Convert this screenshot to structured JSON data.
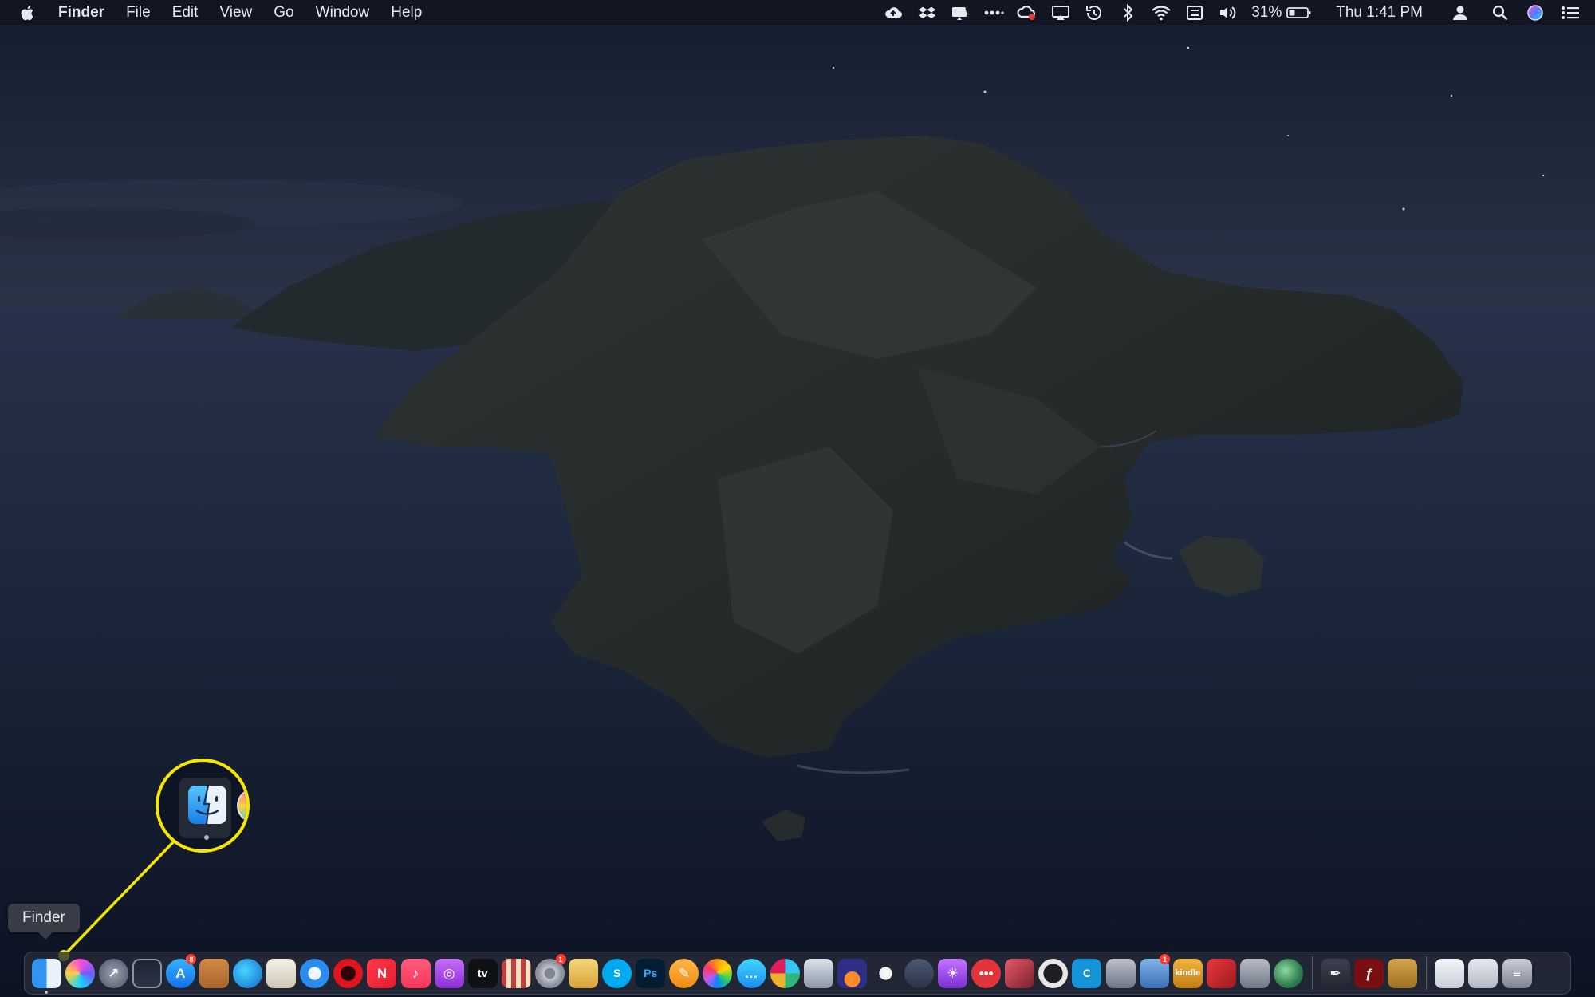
{
  "menubar": {
    "apple_icon": "apple-logo-icon",
    "app_name": "Finder",
    "menus": [
      "File",
      "Edit",
      "View",
      "Go",
      "Window",
      "Help"
    ],
    "status": {
      "battery_percent": "31%",
      "clock": "Thu 1:41 PM"
    }
  },
  "tooltip": {
    "label": "Finder"
  },
  "callout": {
    "color": "#f4e600",
    "target": "Finder"
  },
  "dock": {
    "apps": [
      {
        "name": "Finder",
        "icon": "finder-icon",
        "running": true
      },
      {
        "name": "Siri",
        "icon": "siri-icon"
      },
      {
        "name": "Launchpad",
        "icon": "rocket-icon"
      },
      {
        "name": "Mission Control",
        "icon": "mission-control-icon"
      },
      {
        "name": "App Store",
        "icon": "app-store-icon",
        "badge": "8"
      },
      {
        "name": "Notebook",
        "icon": "notebook-icon"
      },
      {
        "name": "Edge",
        "icon": "edge-icon"
      },
      {
        "name": "Notes",
        "icon": "notes-icon"
      },
      {
        "name": "Safari",
        "icon": "safari-icon"
      },
      {
        "name": "Opera",
        "icon": "opera-icon"
      },
      {
        "name": "News",
        "icon": "news-icon"
      },
      {
        "name": "Music",
        "icon": "music-icon"
      },
      {
        "name": "Podcasts",
        "icon": "podcasts-icon"
      },
      {
        "name": "Apple TV",
        "icon": "apple-tv-icon",
        "label": "tv"
      },
      {
        "name": "Photo Booth",
        "icon": "photo-grid-icon"
      },
      {
        "name": "System Preferences",
        "icon": "gear-icon",
        "badge": "1"
      },
      {
        "name": "Preview",
        "icon": "preview-icon"
      },
      {
        "name": "Skype",
        "icon": "skype-icon",
        "label": "S"
      },
      {
        "name": "Photoshop",
        "icon": "photoshop-icon",
        "label": "Ps"
      },
      {
        "name": "Pages",
        "icon": "pages-icon"
      },
      {
        "name": "Photos",
        "icon": "photos-icon"
      },
      {
        "name": "Messages",
        "icon": "messages-icon"
      },
      {
        "name": "Slack",
        "icon": "slack-icon"
      },
      {
        "name": "Image Capture",
        "icon": "image-capture-icon"
      },
      {
        "name": "Mastodon",
        "icon": "sunset-icon"
      },
      {
        "name": "Gas Mask",
        "icon": "figure-icon"
      },
      {
        "name": "Paste",
        "icon": "printer-icon"
      },
      {
        "name": "Lamp",
        "icon": "bulb-icon"
      },
      {
        "name": "More",
        "icon": "dots-icon"
      },
      {
        "name": "Cube",
        "icon": "cube-icon"
      },
      {
        "name": "OBS",
        "icon": "obs-icon"
      },
      {
        "name": "Curve",
        "icon": "c-icon",
        "label": "C"
      },
      {
        "name": "Automator",
        "icon": "robot-icon"
      },
      {
        "name": "Image Utility",
        "icon": "photo-icon",
        "badge": "1"
      },
      {
        "name": "Kindle",
        "icon": "kindle-icon",
        "label": "kindle"
      },
      {
        "name": "SketchUp",
        "icon": "sketchup-icon"
      },
      {
        "name": "Command",
        "icon": "command-icon"
      },
      {
        "name": "Earth",
        "icon": "globe-icon"
      }
    ],
    "utilities": [
      {
        "name": "Script Editor",
        "icon": "pen-icon"
      },
      {
        "name": "Flash",
        "icon": "flash-icon"
      },
      {
        "name": "Archive",
        "icon": "box-icon"
      }
    ],
    "stacks": [
      {
        "name": "Documents",
        "icon": "document-icon"
      },
      {
        "name": "Downloads",
        "icon": "downloads-icon"
      },
      {
        "name": "Trash",
        "icon": "trash-icon"
      }
    ]
  }
}
